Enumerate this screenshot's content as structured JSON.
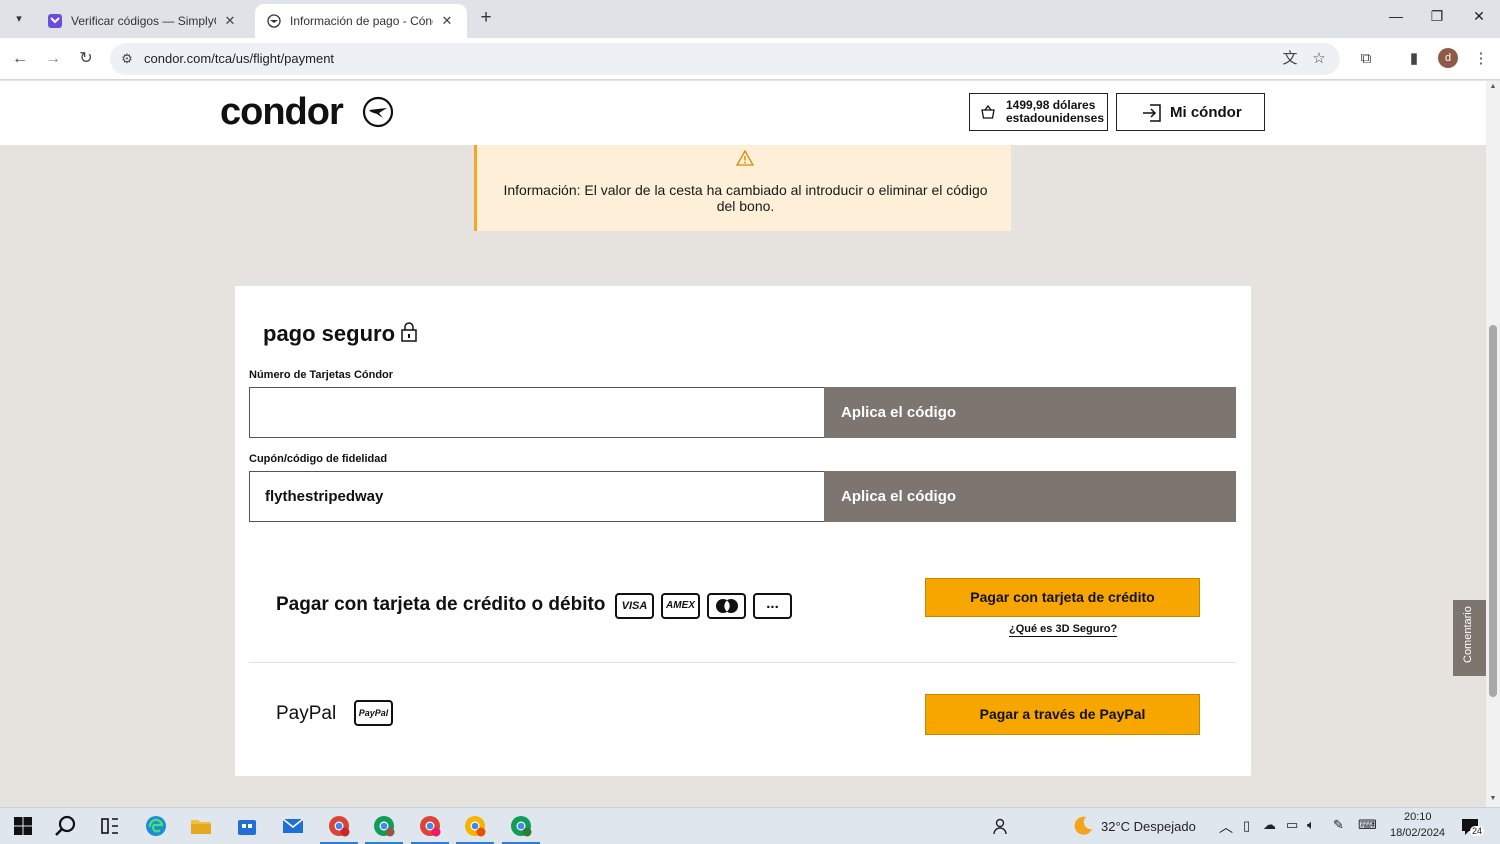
{
  "browser": {
    "tabs": [
      {
        "title": "Verificar códigos — SimplyCodes",
        "active": false,
        "favicon": "simplycodes-icon"
      },
      {
        "title": "Información de pago - Cóndor",
        "active": true,
        "favicon": "condor-icon"
      }
    ],
    "url": "condor.com/tca/us/flight/payment",
    "profile_initial": "d"
  },
  "header": {
    "logo_text": "condor",
    "cart_amount_line1": "1499,98 dólares",
    "cart_amount_line2": "estadounidenses",
    "account_label": "Mi cóndor"
  },
  "notice": {
    "message": "Información: El valor de la cesta ha cambiado al introducir o eliminar el código del bono."
  },
  "payment": {
    "title": "pago seguro",
    "card_number_label": "Número de Tarjetas Cóndor",
    "card_number_value": "",
    "coupon_label": "Cupón/código de fidelidad",
    "coupon_value": "flythestripedway",
    "apply_label": "Aplica el código",
    "credit_title": "Pagar con tarjeta de crédito o débito",
    "card_logos": [
      "VISA",
      "AMEX",
      "",
      "..."
    ],
    "credit_button": "Pagar con tarjeta de crédito",
    "three_d_link": "¿Qué es 3D Seguro?",
    "paypal_title": "PayPal",
    "paypal_logo_text": "PayPal",
    "paypal_button": "Pagar a través de PayPal"
  },
  "feedback_tab": "Comentario",
  "taskbar": {
    "weather": "32°C  Despejado",
    "time": "20:10",
    "date": "18/02/2024",
    "notifications": "24"
  },
  "colors": {
    "accent_orange": "#f7a600",
    "apply_button": "#7d7570",
    "notice_bg": "#fdefd8"
  }
}
